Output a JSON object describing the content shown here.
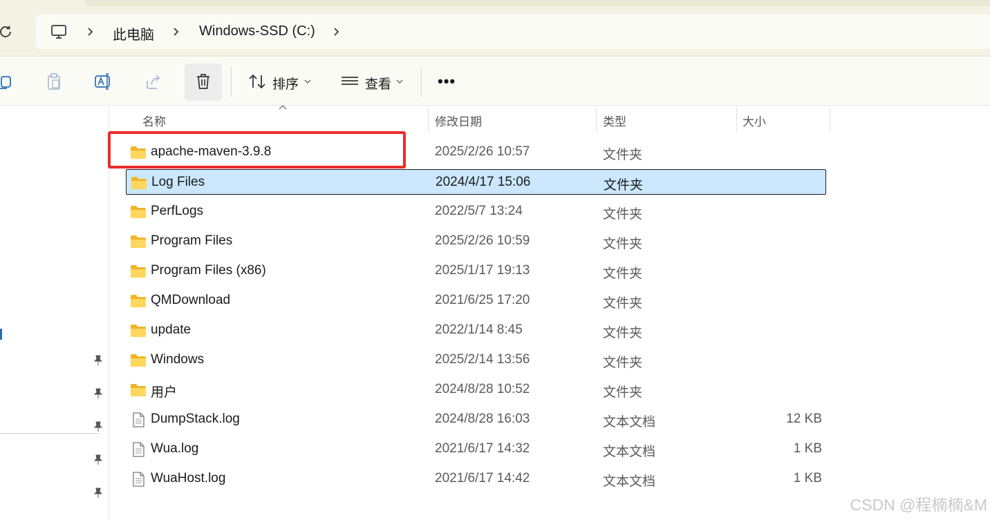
{
  "breadcrumb": {
    "root_label": "此电脑",
    "drive_label": "Windows-SSD (C:)"
  },
  "toolbar": {
    "sort_label": "排序",
    "view_label": "查看",
    "more_label": "•••"
  },
  "columns": {
    "name": "名称",
    "modified": "修改日期",
    "type": "类型",
    "size": "大小"
  },
  "files": [
    {
      "name": "apache-maven-3.9.8",
      "modified": "2025/2/26 10:57",
      "type": "文件夹",
      "size": "",
      "icon": "folder-icon"
    },
    {
      "name": "Log Files",
      "modified": "2024/4/17 15:06",
      "type": "文件夹",
      "size": "",
      "icon": "folder-icon"
    },
    {
      "name": "PerfLogs",
      "modified": "2022/5/7 13:24",
      "type": "文件夹",
      "size": "",
      "icon": "folder-icon"
    },
    {
      "name": "Program Files",
      "modified": "2025/2/26 10:59",
      "type": "文件夹",
      "size": "",
      "icon": "folder-icon"
    },
    {
      "name": "Program Files (x86)",
      "modified": "2025/1/17 19:13",
      "type": "文件夹",
      "size": "",
      "icon": "folder-icon"
    },
    {
      "name": "QMDownload",
      "modified": "2021/6/25 17:20",
      "type": "文件夹",
      "size": "",
      "icon": "folder-icon"
    },
    {
      "name": "update",
      "modified": "2022/1/14 8:45",
      "type": "文件夹",
      "size": "",
      "icon": "folder-icon"
    },
    {
      "name": "Windows",
      "modified": "2025/2/14 13:56",
      "type": "文件夹",
      "size": "",
      "icon": "folder-icon"
    },
    {
      "name": "用户",
      "modified": "2024/8/28 10:52",
      "type": "文件夹",
      "size": "",
      "icon": "folder-icon"
    },
    {
      "name": "DumpStack.log",
      "modified": "2024/8/28 16:03",
      "type": "文本文档",
      "size": "12 KB",
      "icon": "text-file-icon"
    },
    {
      "name": "Wua.log",
      "modified": "2021/6/17 14:32",
      "type": "文本文档",
      "size": "1 KB",
      "icon": "text-file-icon"
    },
    {
      "name": "WuaHost.log",
      "modified": "2021/6/17 14:42",
      "type": "文本文档",
      "size": "1 KB",
      "icon": "text-file-icon"
    }
  ],
  "selected_file": "Log Files",
  "highlighted_file": "apache-maven-3.9.8",
  "colors": {
    "selection_bg": "#cce8ff",
    "highlight_border": "#ee2b2b",
    "folder_yellow": "#f8c948"
  },
  "watermark": "CSDN @程楠楠&M"
}
